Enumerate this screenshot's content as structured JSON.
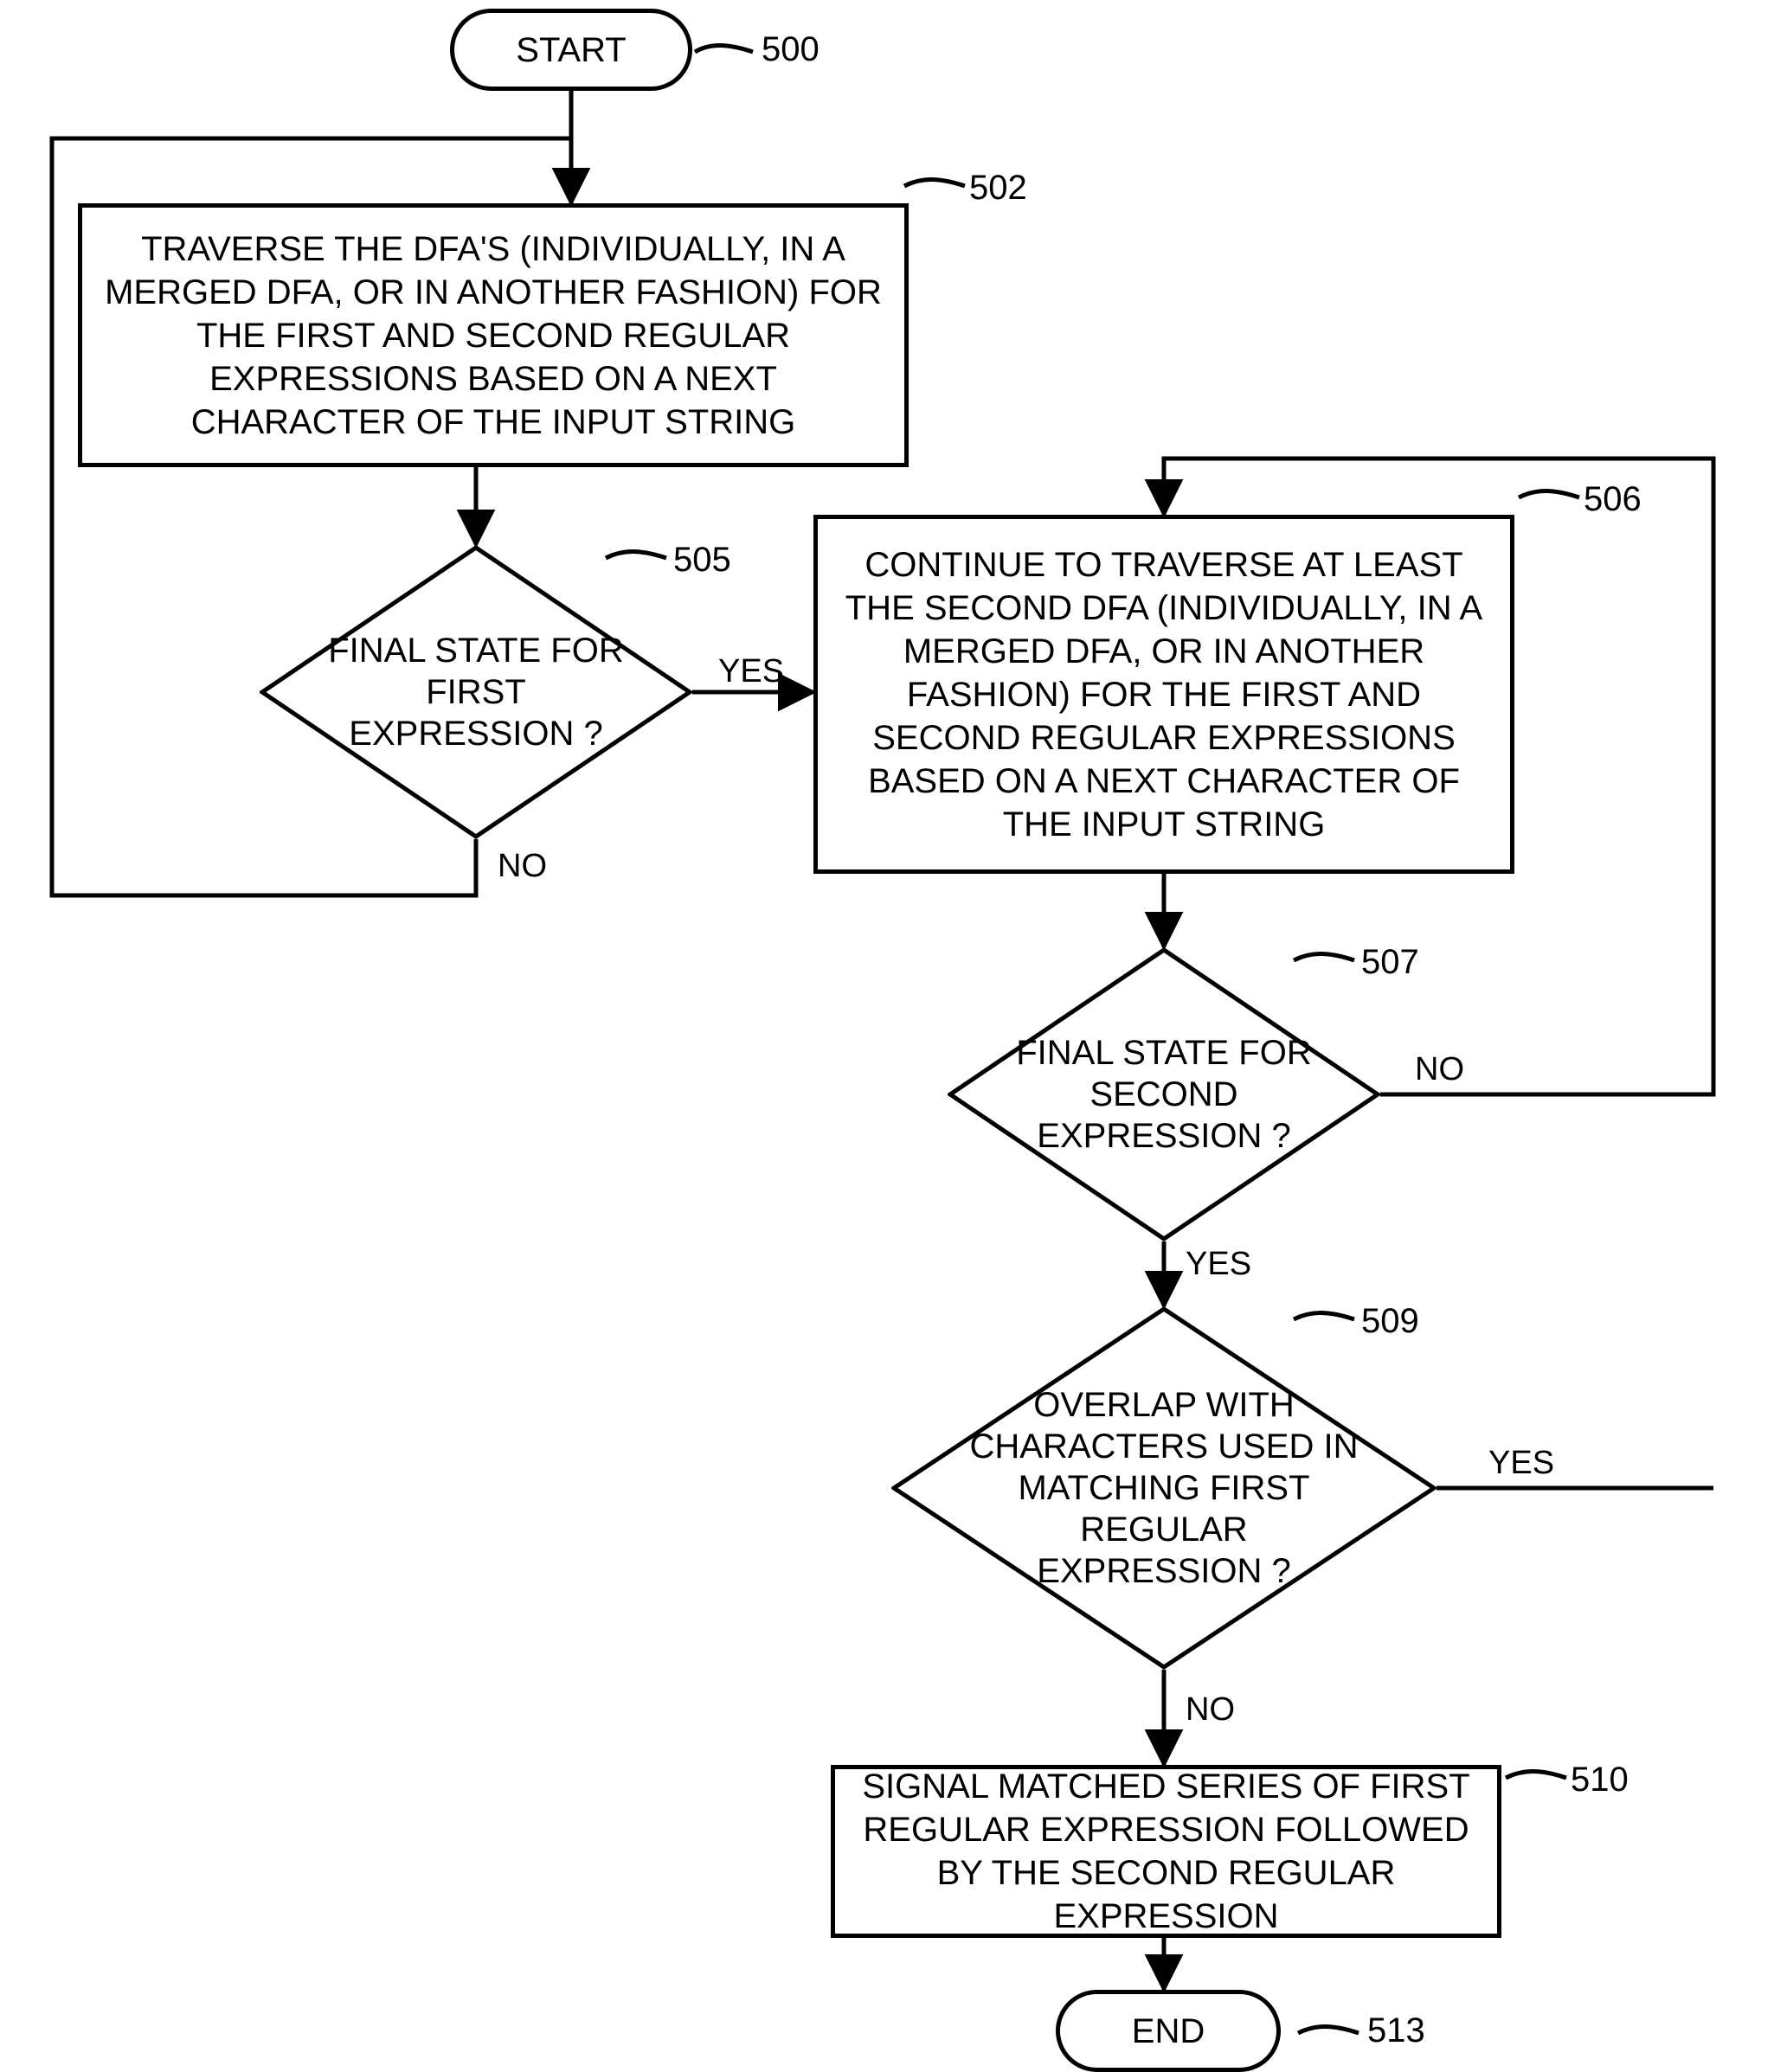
{
  "labels": {
    "start": "START",
    "end": "END",
    "ref500": "500",
    "ref502": "502",
    "ref505": "505",
    "ref506": "506",
    "ref507": "507",
    "ref509": "509",
    "ref510": "510",
    "ref513": "513",
    "box502": "TRAVERSE THE DFA'S (INDIVIDUALLY, IN A MERGED DFA, OR IN ANOTHER FASHION) FOR THE FIRST AND SECOND REGULAR EXPRESSIONS BASED ON A NEXT CHARACTER OF THE INPUT STRING",
    "d505": "FINAL STATE FOR FIRST EXPRESSION ?",
    "box506": "CONTINUE TO TRAVERSE AT LEAST THE SECOND DFA (INDIVIDUALLY, IN A MERGED DFA, OR IN ANOTHER FASHION) FOR THE FIRST AND SECOND REGULAR EXPRESSIONS BASED ON A NEXT CHARACTER OF THE INPUT STRING",
    "d507": "FINAL STATE FOR SECOND EXPRESSION ?",
    "d509": "OVERLAP WITH CHARACTERS USED IN MATCHING FIRST REGULAR EXPRESSION ?",
    "box510": "SIGNAL MATCHED SERIES OF FIRST REGULAR EXPRESSION FOLLOWED BY THE SECOND REGULAR EXPRESSION",
    "yes": "YES",
    "no": "NO"
  },
  "chart_data": {
    "type": "flowchart",
    "nodes": [
      {
        "id": "500",
        "kind": "terminator",
        "label": "START"
      },
      {
        "id": "502",
        "kind": "process",
        "label": "TRAVERSE THE DFA'S (INDIVIDUALLY, IN A MERGED DFA, OR IN ANOTHER FASHION) FOR THE FIRST AND SECOND REGULAR EXPRESSIONS BASED ON A NEXT CHARACTER OF THE INPUT STRING"
      },
      {
        "id": "505",
        "kind": "decision",
        "label": "FINAL STATE FOR FIRST EXPRESSION ?"
      },
      {
        "id": "506",
        "kind": "process",
        "label": "CONTINUE TO TRAVERSE AT LEAST THE SECOND DFA (INDIVIDUALLY, IN A MERGED DFA, OR IN ANOTHER FASHION) FOR THE FIRST AND SECOND REGULAR EXPRESSIONS BASED ON A NEXT CHARACTER OF THE INPUT STRING"
      },
      {
        "id": "507",
        "kind": "decision",
        "label": "FINAL STATE FOR SECOND EXPRESSION ?"
      },
      {
        "id": "509",
        "kind": "decision",
        "label": "OVERLAP WITH CHARACTERS USED IN MATCHING FIRST REGULAR EXPRESSION ?"
      },
      {
        "id": "510",
        "kind": "process",
        "label": "SIGNAL MATCHED SERIES OF FIRST REGULAR EXPRESSION FOLLOWED BY THE SECOND REGULAR EXPRESSION"
      },
      {
        "id": "513",
        "kind": "terminator",
        "label": "END"
      }
    ],
    "edges": [
      {
        "from": "500",
        "to": "502",
        "label": null
      },
      {
        "from": "502",
        "to": "505",
        "label": null
      },
      {
        "from": "505",
        "to": "506",
        "label": "YES"
      },
      {
        "from": "505",
        "to": "502",
        "label": "NO"
      },
      {
        "from": "506",
        "to": "507",
        "label": null
      },
      {
        "from": "507",
        "to": "509",
        "label": "YES"
      },
      {
        "from": "507",
        "to": "506",
        "label": "NO"
      },
      {
        "from": "509",
        "to": "510",
        "label": "NO"
      },
      {
        "from": "509",
        "to": "506",
        "label": "YES"
      },
      {
        "from": "510",
        "to": "513",
        "label": null
      }
    ]
  }
}
